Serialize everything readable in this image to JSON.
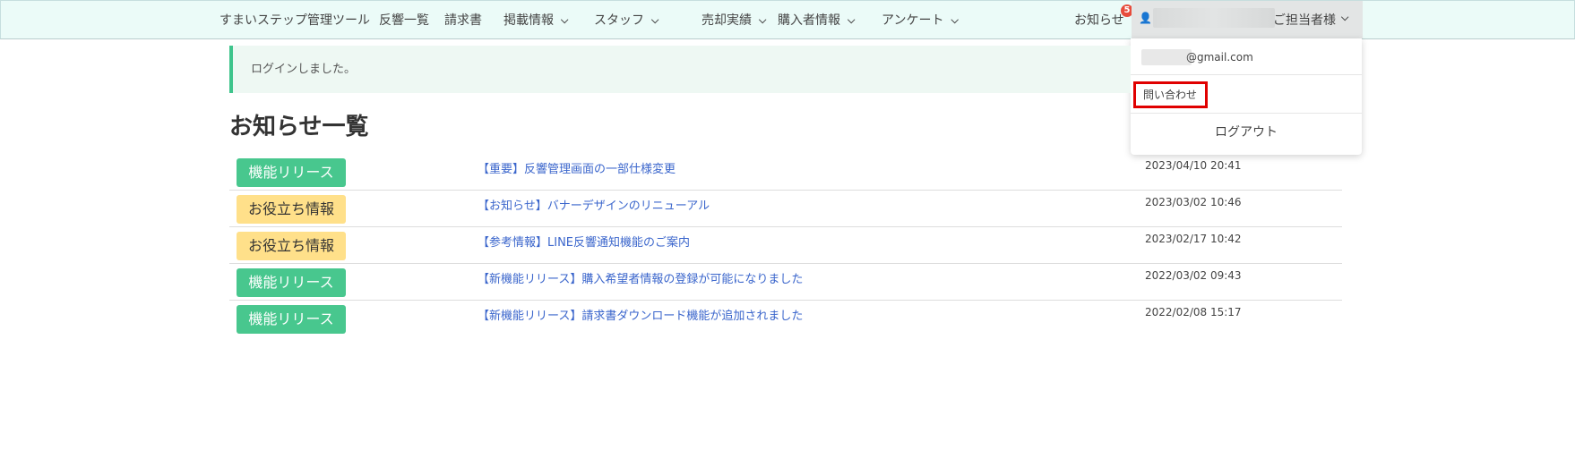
{
  "nav": {
    "brand": "すまいステップ管理ツール",
    "items": [
      {
        "label": "反響一覧",
        "dropdown": false
      },
      {
        "label": "請求書",
        "dropdown": false
      },
      {
        "label": "掲載情報",
        "dropdown": true
      },
      {
        "label": "スタッフ",
        "dropdown": true
      },
      {
        "label": "売却実績",
        "dropdown": true
      },
      {
        "label": "購入者情報",
        "dropdown": true
      },
      {
        "label": "アンケート",
        "dropdown": true
      }
    ],
    "notifications": {
      "label": "お知らせ",
      "count": "5"
    },
    "user": {
      "label": "ご担当者様"
    }
  },
  "user_menu": {
    "email_suffix": "@gmail.com",
    "contact": "問い合わせ",
    "logout": "ログアウト"
  },
  "alert": {
    "message": "ログインしました。"
  },
  "page": {
    "title": "お知らせ一覧"
  },
  "news": [
    {
      "tag": "機能リリース",
      "tag_type": "release",
      "title": "【重要】反響管理画面の一部仕様変更",
      "date": "2023/04/10 20:41"
    },
    {
      "tag": "お役立ち情報",
      "tag_type": "info",
      "title": "【お知らせ】バナーデザインのリニューアル",
      "date": "2023/03/02 10:46"
    },
    {
      "tag": "お役立ち情報",
      "tag_type": "info",
      "title": "【参考情報】LINE反響通知機能のご案内",
      "date": "2023/02/17 10:42"
    },
    {
      "tag": "機能リリース",
      "tag_type": "release",
      "title": "【新機能リリース】購入希望者情報の登録が可能になりました",
      "date": "2022/03/02 09:43"
    },
    {
      "tag": "機能リリース",
      "tag_type": "release",
      "title": "【新機能リリース】請求書ダウンロード機能が追加されました",
      "date": "2022/02/08 15:17"
    }
  ],
  "colors": {
    "release": "#48c78e",
    "info": "#ffe08a",
    "accent": "#3ec48c",
    "highlight": "#e00000"
  }
}
